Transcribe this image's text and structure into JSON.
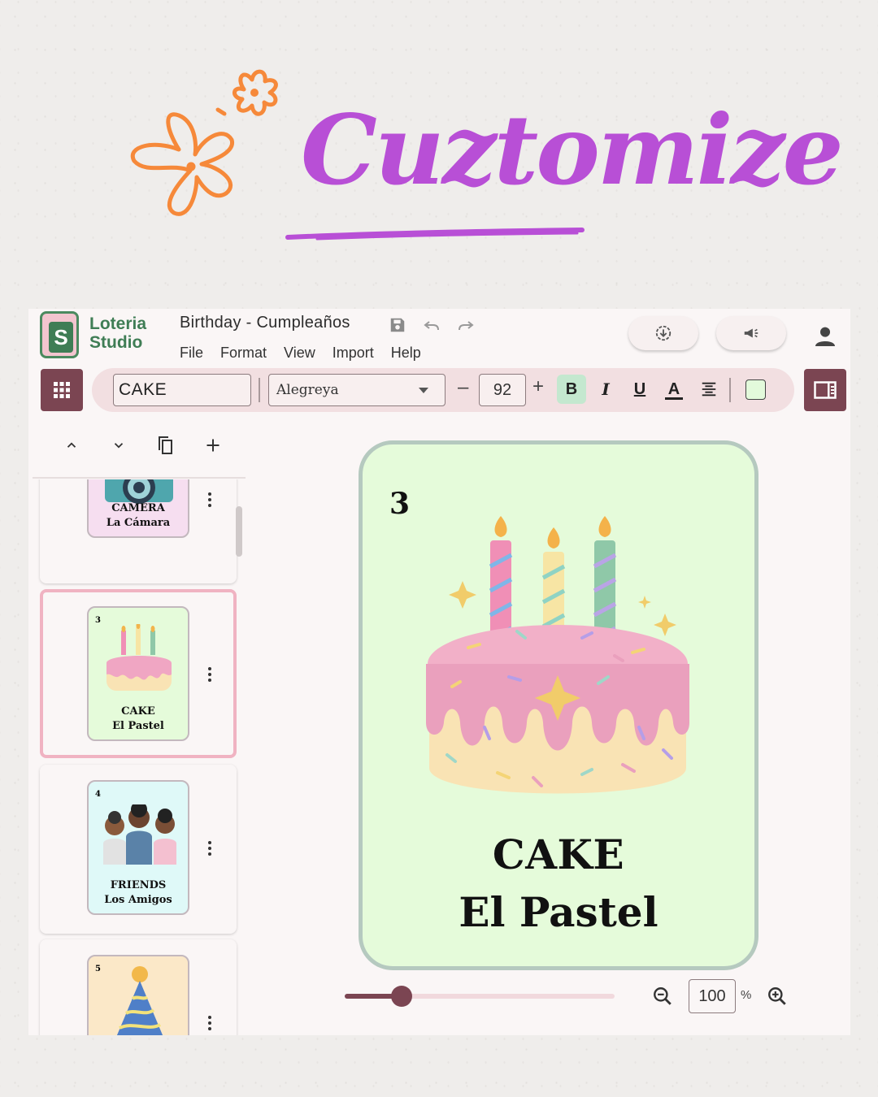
{
  "hero": {
    "title": "Cuztomize"
  },
  "app": {
    "logo_line1": "Loteria",
    "logo_line2": "Studio",
    "logo_letter": "S",
    "document_title": "Birthday - Cumpleaños",
    "menu": [
      "File",
      "Format",
      "View",
      "Import",
      "Help"
    ],
    "title_icons": [
      "save-icon",
      "undo-icon",
      "redo-icon"
    ],
    "actions": [
      "download-icon",
      "megaphone-icon",
      "account-icon"
    ]
  },
  "toolbar": {
    "text_value": "CAKE",
    "font": "Alegreya",
    "size_minus": "–",
    "font_size": "92",
    "size_plus": "+",
    "bold": "B",
    "italic": "I",
    "underline": "U",
    "text_color": "A",
    "bold_active": true,
    "fill_color": "#e3fadb"
  },
  "sidebar": {
    "actions": [
      "chevron-up-icon",
      "chevron-down-icon",
      "copy-icon",
      "plus-icon"
    ],
    "cards": [
      {
        "number": "",
        "english": "CAMERA",
        "spanish": "La Cámara",
        "bg": "#f6def0"
      },
      {
        "number": "3",
        "english": "CAKE",
        "spanish": "El Pastel",
        "bg": "#e5fbda",
        "selected": true
      },
      {
        "number": "4",
        "english": "FRIENDS",
        "spanish": "Los Amigos",
        "bg": "#dff9f8"
      },
      {
        "number": "5",
        "english": "",
        "spanish": "",
        "bg": "#fbe8c8"
      }
    ]
  },
  "canvas": {
    "number": "3",
    "english": "CAKE",
    "spanish": "El Pastel",
    "background": "#e5fbda",
    "border": "#b5c9bf"
  },
  "zoom": {
    "value": "100",
    "unit": "%",
    "slider_fraction": 0.21
  },
  "colors": {
    "accent": "#7b4552",
    "title_purple": "#b84fd6",
    "flower_orange": "#f6893a"
  }
}
